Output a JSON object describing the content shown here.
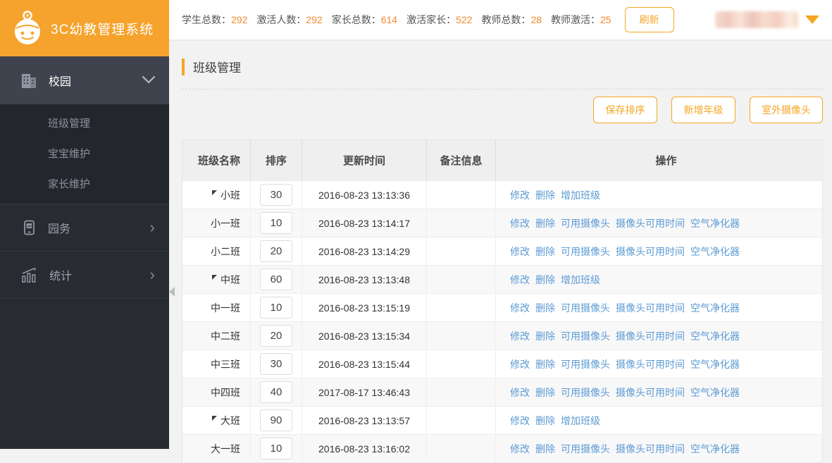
{
  "app": {
    "title": "3C幼教管理系统"
  },
  "colors": {
    "accent": "#f5a623",
    "stat_value": "#f08a2d",
    "link": "#5c9bd3",
    "sidebar_bg": "#282b32",
    "logo_bg": "#f5a32c"
  },
  "topbar": {
    "stats": [
      {
        "label": "学生总数",
        "value": "292"
      },
      {
        "label": "激活人数",
        "value": "292"
      },
      {
        "label": "家长总数",
        "value": "614"
      },
      {
        "label": "激活家长",
        "value": "522"
      },
      {
        "label": "教师总数",
        "value": "28"
      },
      {
        "label": "教师激活",
        "value": "25"
      }
    ],
    "refresh_label": "刷新"
  },
  "sidebar": {
    "groups": [
      {
        "label": "校园",
        "icon": "building-icon",
        "expanded": true,
        "children": [
          "班级管理",
          "宝宝维护",
          "家长维护"
        ]
      },
      {
        "label": "园务",
        "icon": "app-phone-icon",
        "expanded": false,
        "children": []
      },
      {
        "label": "统计",
        "icon": "stats-chart-icon",
        "expanded": false,
        "children": []
      }
    ]
  },
  "page": {
    "title": "班级管理",
    "buttons": [
      "保存排序",
      "新增年级",
      "室外摄像头"
    ]
  },
  "table": {
    "headers": [
      "班级名称",
      "排序",
      "更新时间",
      "备注信息",
      "操作"
    ],
    "parent_actions": [
      "修改",
      "删除",
      "增加班级"
    ],
    "child_actions": [
      "修改",
      "删除",
      "可用摄像头",
      "摄像头可用时间",
      "空气净化器"
    ],
    "rows": [
      {
        "name": "小班",
        "parent": true,
        "sort": "30",
        "time": "2016-08-23 13:13:36",
        "note": ""
      },
      {
        "name": "小一班",
        "parent": false,
        "sort": "10",
        "time": "2016-08-23 13:14:17",
        "note": ""
      },
      {
        "name": "小二班",
        "parent": false,
        "sort": "20",
        "time": "2016-08-23 13:14:29",
        "note": ""
      },
      {
        "name": "中班",
        "parent": true,
        "sort": "60",
        "time": "2016-08-23 13:13:48",
        "note": ""
      },
      {
        "name": "中一班",
        "parent": false,
        "sort": "10",
        "time": "2016-08-23 13:15:19",
        "note": ""
      },
      {
        "name": "中二班",
        "parent": false,
        "sort": "20",
        "time": "2016-08-23 13:15:34",
        "note": ""
      },
      {
        "name": "中三班",
        "parent": false,
        "sort": "30",
        "time": "2016-08-23 13:15:44",
        "note": ""
      },
      {
        "name": "中四班",
        "parent": false,
        "sort": "40",
        "time": "2017-08-17 13:46:43",
        "note": ""
      },
      {
        "name": "大班",
        "parent": true,
        "sort": "90",
        "time": "2016-08-23 13:13:57",
        "note": ""
      },
      {
        "name": "大一班",
        "parent": false,
        "sort": "10",
        "time": "2016-08-23 13:16:02",
        "note": ""
      }
    ]
  }
}
